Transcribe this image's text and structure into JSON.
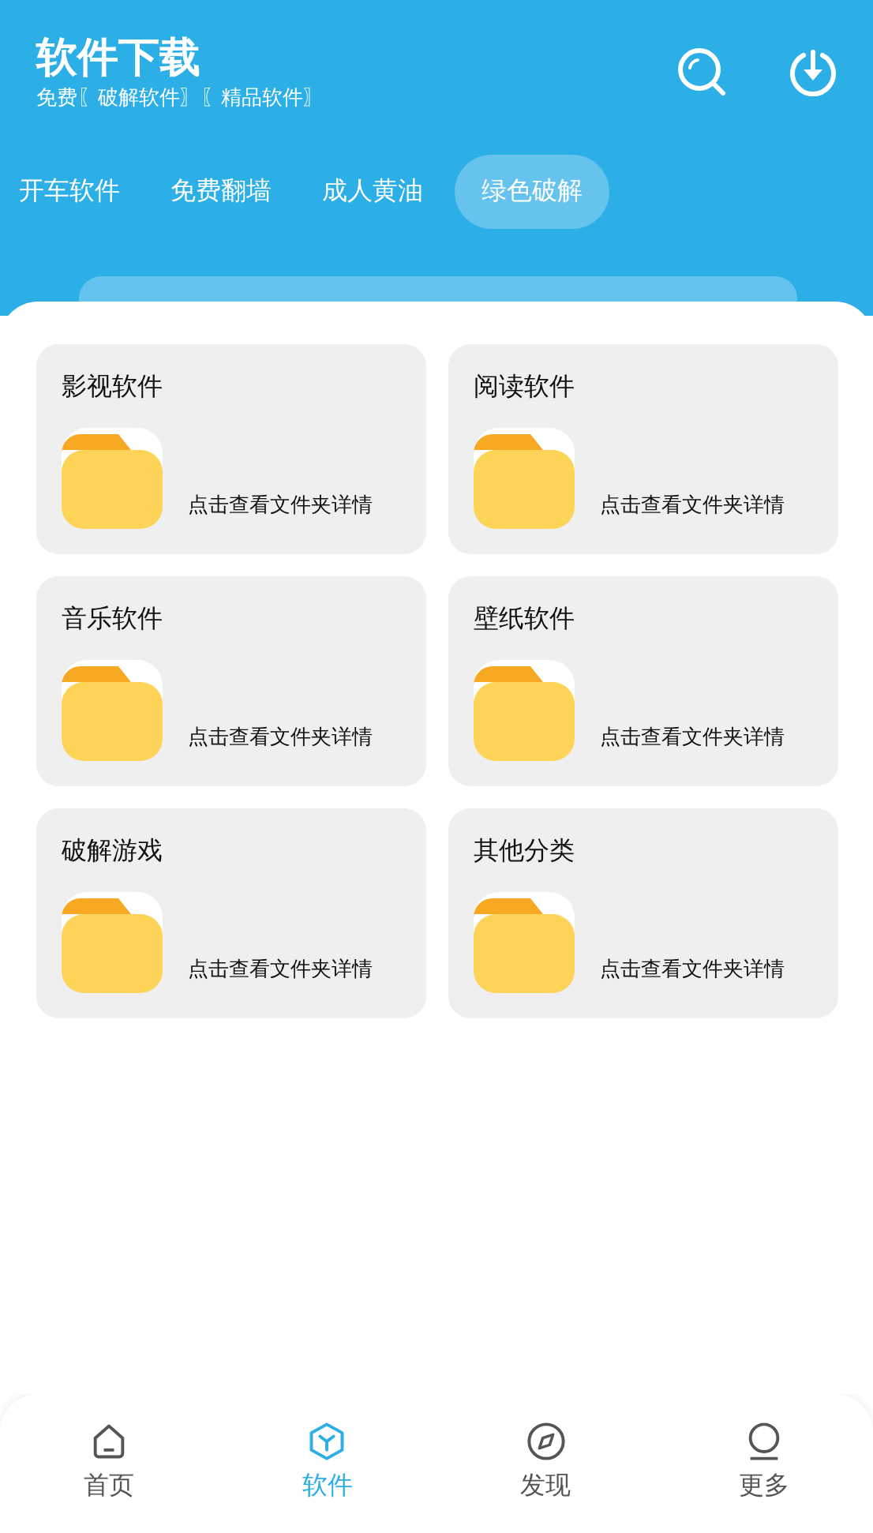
{
  "header": {
    "title": "软件下载",
    "subtitle": "免费〖破解软件〗〖精品软件〗"
  },
  "tabs": [
    {
      "label": "开车软件",
      "selected": false
    },
    {
      "label": "免费翻墙",
      "selected": false
    },
    {
      "label": "成人黄油",
      "selected": false
    },
    {
      "label": "绿色破解",
      "selected": true
    }
  ],
  "folders": [
    {
      "name": "影视软件",
      "hint": "点击查看文件夹详情"
    },
    {
      "name": "阅读软件",
      "hint": "点击查看文件夹详情"
    },
    {
      "name": "音乐软件",
      "hint": "点击查看文件夹详情"
    },
    {
      "name": "壁纸软件",
      "hint": "点击查看文件夹详情"
    },
    {
      "name": "破解游戏",
      "hint": "点击查看文件夹详情"
    },
    {
      "name": "其他分类",
      "hint": "点击查看文件夹详情"
    }
  ],
  "bottom_nav": [
    {
      "label": "首页",
      "selected": false
    },
    {
      "label": "软件",
      "selected": true
    },
    {
      "label": "发现",
      "selected": false
    },
    {
      "label": "更多",
      "selected": false
    }
  ]
}
